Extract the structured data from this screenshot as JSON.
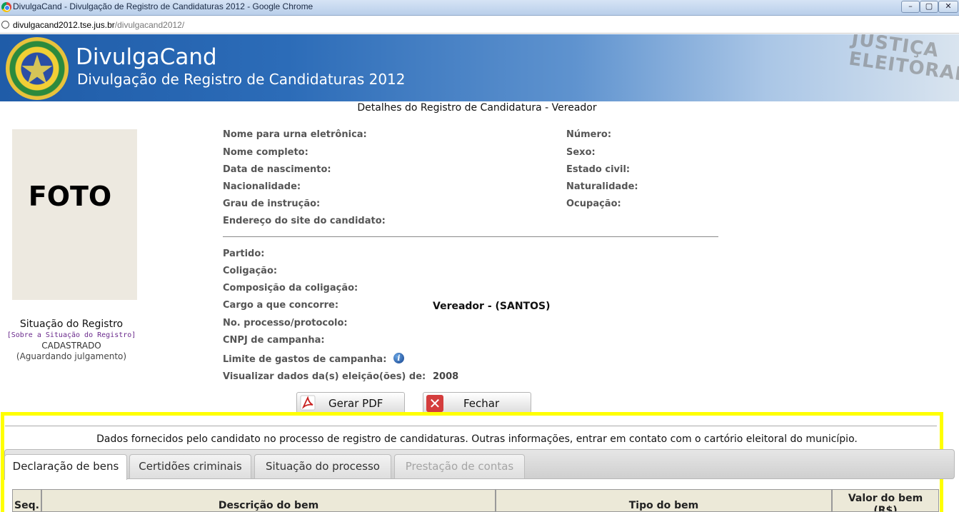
{
  "browser": {
    "window_title": "DivulgaCand - Divulgação de Registro de Candidaturas 2012 - Google Chrome",
    "url_host": "divulgacand2012.tse.jus.br",
    "url_path": "/divulgacand2012/",
    "controls": {
      "minimize": "–",
      "maximize": "▢",
      "close": "✕"
    }
  },
  "banner": {
    "app_name": "DivulgaCand",
    "app_subtitle": "Divulgação de Registro de Candidaturas 2012",
    "watermark_line1": "JUSTIÇA",
    "watermark_line2": "ELEITORAL"
  },
  "page": {
    "heading": "Detalhes do Registro de Candidatura - Vereador"
  },
  "photo": {
    "placeholder": "FOTO"
  },
  "registration_status": {
    "title": "Situação do Registro",
    "link": "[Sobre a Situação do Registro]",
    "value": "CADASTRADO",
    "note": "(Aguardando julgamento)"
  },
  "candidate": {
    "labels": {
      "ballot_name": "Nome para urna eletrônica:",
      "full_name": "Nome completo:",
      "birth_date": "Data de nascimento:",
      "nationality": "Nacionalidade:",
      "education": "Grau de instrução:",
      "site": "Endereço do site do candidato:",
      "number": "Número:",
      "sex": "Sexo:",
      "marital_status": "Estado civil:",
      "birthplace": "Naturalidade:",
      "occupation": "Ocupação:",
      "party": "Partido:",
      "coalition": "Coligação:",
      "coalition_composition": "Composição da coligação:",
      "office": "Cargo a que concorre:",
      "process_number": "No. processo/protocolo:",
      "cnpj": "CNPJ de campanha:",
      "spending_limit": "Limite de gastos de campanha:",
      "view_election_data": "Visualizar dados da(s) eleição(ões) de:"
    },
    "values": {
      "office": "Vereador - (SANTOS)",
      "election_year": "2008"
    }
  },
  "actions": {
    "generate_pdf": "Gerar PDF",
    "close": "Fechar"
  },
  "notice": "Dados fornecidos pelo candidato no processo de registro de candidaturas.  Outras informações, entrar em contato com o cartório eleitoral do município.",
  "tabs": [
    {
      "label": "Declaração de bens"
    },
    {
      "label": "Certidões criminais"
    },
    {
      "label": "Situação do processo"
    },
    {
      "label": "Prestação de contas"
    }
  ],
  "assets_table": {
    "headers": {
      "seq": "Seq.",
      "description": "Descrição do bem",
      "type": "Tipo do bem",
      "value_line1": "Valor do bem",
      "value_line2": "(R$)"
    }
  },
  "colors": {
    "highlight": "#ffff00",
    "banner_blue": "#1f5ca8",
    "label_gray": "#555555"
  }
}
